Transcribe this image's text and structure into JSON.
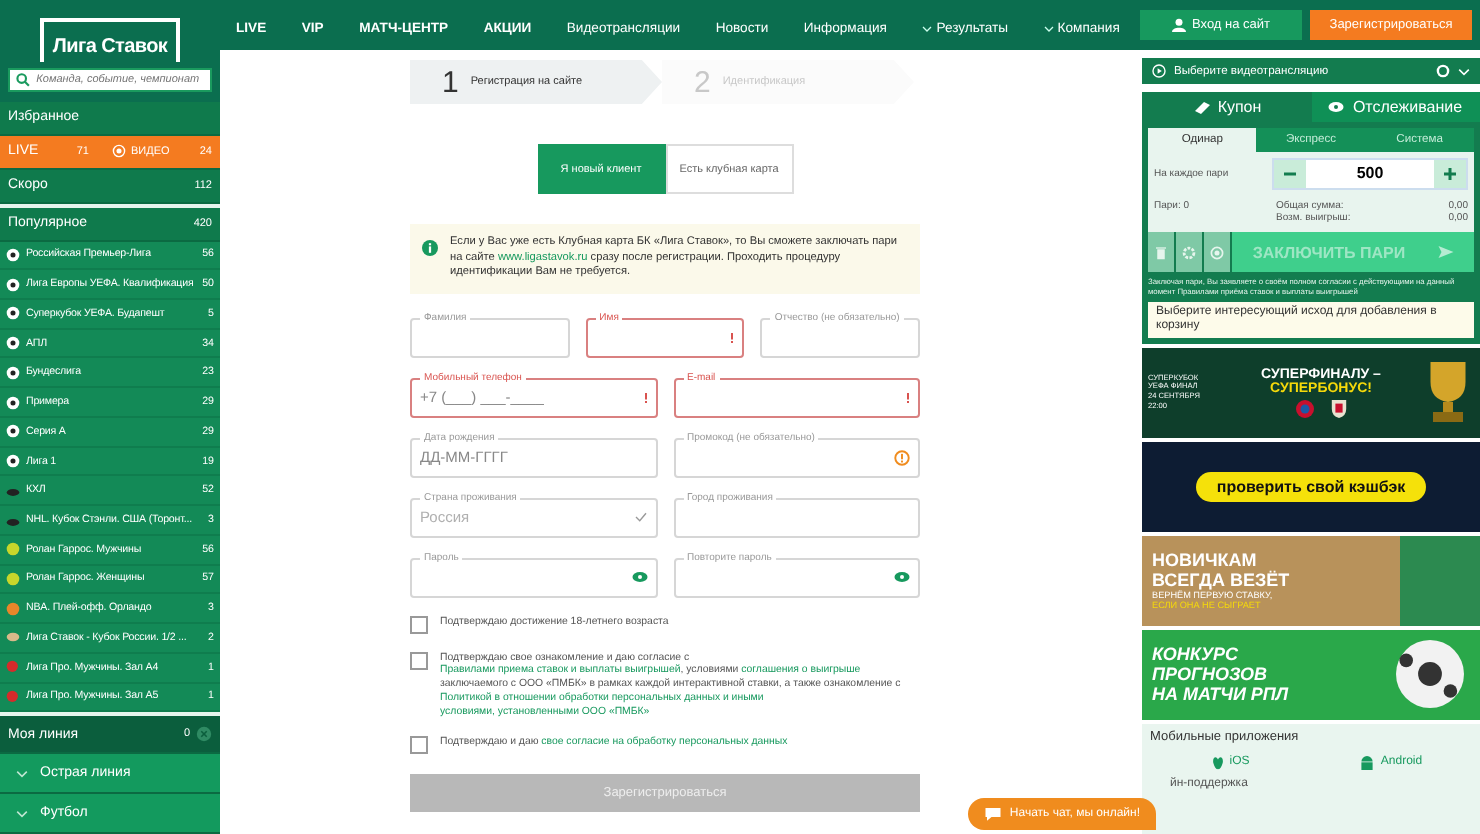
{
  "sidebar": {
    "logo": "Лига Ставок",
    "search": {
      "placeholder": "Команда, событие, чемпионат"
    },
    "favorites": "Избранное",
    "live": {
      "label": "LIVE",
      "count": "71",
      "video_label": "ВИДЕО",
      "video_count": "24"
    },
    "soon": {
      "label": "Скоро",
      "count": "112"
    },
    "popular": {
      "label": "Популярное",
      "count": "420"
    },
    "items": [
      {
        "kind": "football",
        "label": "Российская Премьер-Лига",
        "count": "56"
      },
      {
        "kind": "football",
        "label": "Лига Европы УЕФА. Квалификация",
        "count": "50"
      },
      {
        "kind": "football",
        "label": "Суперкубок УЕФА. Будапешт",
        "count": "5"
      },
      {
        "kind": "football",
        "label": "АПЛ",
        "count": "34"
      },
      {
        "kind": "football",
        "label": "Бундеслига",
        "count": "23"
      },
      {
        "kind": "football",
        "label": "Примера",
        "count": "29"
      },
      {
        "kind": "football",
        "label": "Серия А",
        "count": "29"
      },
      {
        "kind": "football",
        "label": "Лига 1",
        "count": "19"
      },
      {
        "kind": "hockey",
        "label": "КХЛ",
        "count": "52"
      },
      {
        "kind": "hockey",
        "label": "NHL. Кубок Стэнли. США (Торонт...",
        "count": "3"
      },
      {
        "kind": "tennis",
        "label": "Ролан Гаррос. Мужчины",
        "count": "56"
      },
      {
        "kind": "tennis",
        "label": "Ролан Гаррос. Женщины",
        "count": "57"
      },
      {
        "kind": "basketball",
        "label": "NBA. Плей-офф. Орландо",
        "count": "3"
      },
      {
        "kind": "rugby",
        "label": "Лига Ставок - Кубок России. 1/2 ...",
        "count": "2"
      },
      {
        "kind": "table_tennis",
        "label": "Лига Про. Мужчины. Зал А4",
        "count": "1"
      },
      {
        "kind": "table_tennis",
        "label": "Лига Про. Мужчины. Зал А5",
        "count": "1"
      }
    ],
    "my_line": {
      "label": "Моя линия",
      "count": "0"
    },
    "groups": [
      "Острая линия",
      "Футбол"
    ]
  },
  "nav": [
    {
      "label": "LIVE",
      "bold": true,
      "dropdown": false
    },
    {
      "label": "VIP",
      "bold": true,
      "dropdown": false
    },
    {
      "label": "МАТЧ-ЦЕНТР",
      "bold": true,
      "dropdown": false
    },
    {
      "label": "АКЦИИ",
      "bold": true,
      "dropdown": false
    },
    {
      "label": "Видеотрансляции",
      "bold": false,
      "dropdown": false
    },
    {
      "label": "Новости",
      "bold": false,
      "dropdown": false
    },
    {
      "label": "Информация",
      "bold": false,
      "dropdown": false
    },
    {
      "label": "Результаты",
      "bold": false,
      "dropdown": true
    },
    {
      "label": "Компания",
      "bold": false,
      "dropdown": true
    }
  ],
  "steps": [
    {
      "number": "1",
      "label": "Регистрация на сайте",
      "selected": true
    },
    {
      "number": "2",
      "label": "Идентификация",
      "selected": false
    }
  ],
  "client_tabs": [
    {
      "label": "Я новый клиент",
      "selected": true
    },
    {
      "label": "Есть клубная карта",
      "selected": false
    }
  ],
  "info": [
    {
      "text": "Если у Вас уже есть Клубная карта БК «Лига Ставок», то Вы сможете заключать пари на сайте ",
      "link": false
    },
    {
      "text": "www.ligastavok.ru",
      "link": true
    },
    {
      "text": " сразу после регистрации. Проходить процедуру идентификации Вам не требуется.",
      "link": false
    }
  ],
  "form_rows": [
    [
      {
        "label": "Фамилия",
        "error": false,
        "kind": "text"
      },
      {
        "label": "Имя",
        "error": true,
        "kind": "text"
      },
      {
        "label": "Отчество (не обязательно)",
        "error": false,
        "kind": "text"
      }
    ],
    [
      {
        "label": "Мобильный телефон",
        "placeholder": "+7 (___) ___-____",
        "error": true,
        "kind": "text"
      },
      {
        "label": "E-mail",
        "error": true,
        "kind": "text"
      }
    ],
    [
      {
        "label": "Дата рождения",
        "placeholder": "ДД-ММ-ГГГГ",
        "error": false,
        "kind": "text"
      },
      {
        "label": "Промокод (не обязательно)",
        "error": false,
        "kind": "promo"
      }
    ],
    [
      {
        "label": "Страна проживания",
        "placeholder": "Россия",
        "error": false,
        "kind": "select"
      },
      {
        "label": "Город проживания",
        "error": false,
        "kind": "text"
      }
    ],
    [
      {
        "label": "Пароль",
        "error": false,
        "kind": "password"
      },
      {
        "label": "Повторите пароль",
        "error": false,
        "kind": "password"
      }
    ]
  ],
  "consents": [
    {
      "checked": false,
      "text": [
        {
          "text": "Подтверждаю достижение 18-летнего возраста",
          "link": false
        }
      ]
    },
    {
      "checked": false,
      "text": [
        {
          "text": "Подтверждаю свое ознакомление и даю согласие с ",
          "link": false
        },
        {
          "text": "Правилами приема ставок и выплаты выигрышей",
          "link": true
        },
        {
          "text": ", условиями ",
          "link": false
        },
        {
          "text": "соглашения о выигрыше",
          "link": true
        },
        {
          "text": " заключаемого с ООО «ПМБК» в рамках каждой интерактивной ставки, а также ознакомление с ",
          "link": false
        },
        {
          "text": "Политикой в отношении обработки персональных данных и иными",
          "link": true
        },
        {
          "text": "условиями, установленными ООО «ПМБК»",
          "link": true
        }
      ]
    },
    {
      "checked": false,
      "text": [
        {
          "text": "Подтверждаю и даю ",
          "link": false
        },
        {
          "text": "свое согласие на обработку персональных данных",
          "link": true
        }
      ]
    }
  ],
  "submit": {
    "label": "Зарегистрироваться",
    "disabled": true
  },
  "chat": "Начать чат, мы онлайн!",
  "account_buttons": [
    {
      "kind": "login",
      "label": "Вход на сайт"
    },
    {
      "kind": "register",
      "label": "Зарегистрироваться"
    }
  ],
  "video_select": "Выберите видеотрансляцию",
  "coupon": {
    "tabs": [
      {
        "label": "Купон",
        "kind": "coupon",
        "selected": true
      },
      {
        "label": "Отслеживание",
        "kind": "tracking",
        "selected": false
      }
    ],
    "bet_types": [
      {
        "label": "Одинар",
        "selected": true
      },
      {
        "label": "Экспресс",
        "selected": false
      },
      {
        "label": "Система",
        "selected": false
      }
    ],
    "stake_label": "На каждое пари",
    "stake": "500",
    "bets": "Пари: 0",
    "totals": [
      {
        "label": "Общая сумма:",
        "value": "0,00"
      },
      {
        "label": "Возм. выигрыш:",
        "value": "0,00"
      }
    ],
    "submit": {
      "label": "ЗАКЛЮЧИТЬ ПАРИ",
      "disabled": true
    },
    "disclaimer": "Заключая пари, Вы заявляете о своём полном согласии с действующими на данный момент Правилами приёма ставок и выплаты выигрышей",
    "hint": "Выберите интересующий исход для добавления в корзину"
  },
  "banners": [
    {
      "kind": "superfinal",
      "texts": [
        "СУПЕРФИНАЛУ –",
        "СУПЕРБОНУС!",
        "СУПЕРКУБОК УЕФА ФИНАЛ",
        "24 СЕНТЯБРЯ",
        "22:00"
      ]
    },
    {
      "kind": "cashback",
      "texts": [
        "проверить свой кэшбэк"
      ]
    },
    {
      "kind": "newcomers",
      "texts": [
        "НОВИЧКАМ",
        "ВСЕГДА ВЕЗЁТ",
        "ВЕРНЁМ ПЕРВУЮ СТАВКУ,",
        "ЕСЛИ ОНА НЕ СЫГРАЕТ"
      ]
    },
    {
      "kind": "contest",
      "texts": [
        "КОНКУРС",
        "ПРОГНОЗОВ",
        "НА МАТЧИ РПЛ"
      ]
    }
  ],
  "apps": {
    "title": "Мобильные приложения",
    "platforms": [
      {
        "kind": "ios",
        "label": "iOS"
      },
      {
        "kind": "android",
        "label": "Android"
      }
    ]
  },
  "support": "йн-поддержка"
}
